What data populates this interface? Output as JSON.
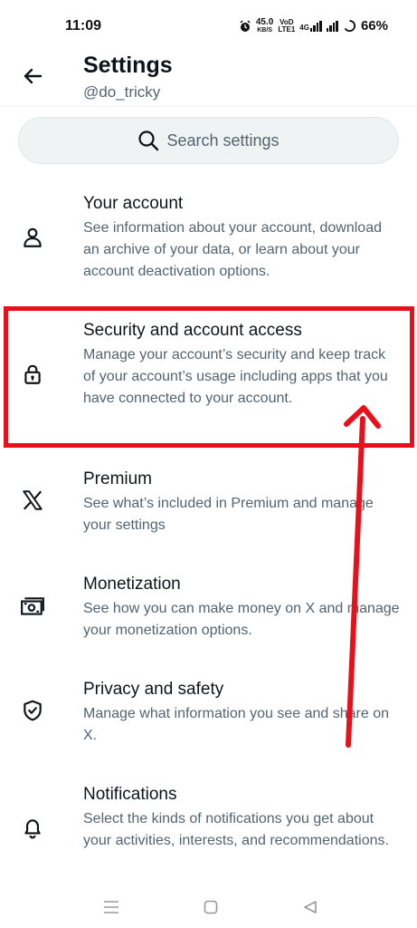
{
  "status_bar": {
    "time": "11:09",
    "net_speed_value": "45.0",
    "net_speed_unit": "KB/S",
    "volte_top": "VoD",
    "volte_bottom": "LTE1",
    "network_type": "4G",
    "battery": "66%"
  },
  "header": {
    "back_icon": "arrow-left-icon",
    "title": "Settings",
    "handle": "@do_tricky"
  },
  "search": {
    "icon": "search-icon",
    "placeholder": "Search settings"
  },
  "settings_items": [
    {
      "icon": "person-icon",
      "title": "Your account",
      "description": "See information about your account, download an archive of your data, or learn about your account deactivation options."
    },
    {
      "icon": "lock-icon",
      "title": "Security and account access",
      "description": "Manage your account’s security and keep track of your account’s usage including apps that you have connected to your account."
    },
    {
      "icon": "x-logo-icon",
      "title": "Premium",
      "description": "See what’s included in Premium and manage your settings"
    },
    {
      "icon": "money-icon",
      "title": "Monetization",
      "description": "See how you can make money on X and manage your monetization options."
    },
    {
      "icon": "shield-check-icon",
      "title": "Privacy and safety",
      "description": "Manage what information you see and share on X."
    },
    {
      "icon": "bell-icon",
      "title": "Notifications",
      "description": "Select the kinds of notifications you get about your activities, interests, and recommendations."
    }
  ],
  "annotation": {
    "highlight_color": "#e8101a",
    "arrow_color": "#e8101a"
  },
  "nav_bar": {
    "recents_icon": "menu-lines-icon",
    "home_icon": "square-home-icon",
    "back_icon": "triangle-back-icon"
  }
}
